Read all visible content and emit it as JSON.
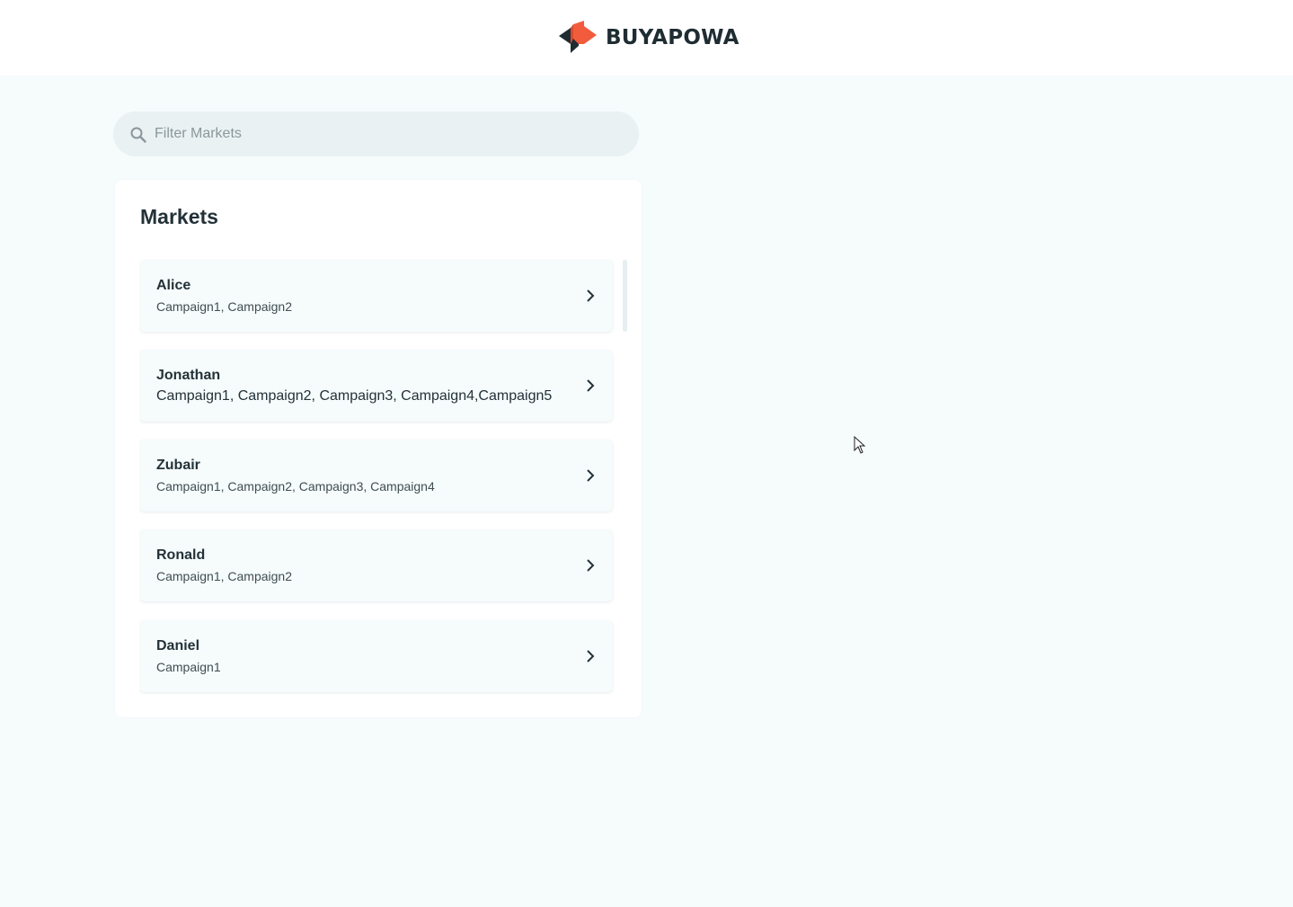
{
  "header": {
    "brand_name": "BUYAPOWA",
    "logo_colors": {
      "primary": "#f25c3c",
      "secondary": "#1f2d33"
    }
  },
  "search": {
    "placeholder": "Filter Markets",
    "value": "",
    "icon": "search-icon"
  },
  "markets": {
    "title": "Markets",
    "items": [
      {
        "name": "Alice",
        "campaigns": "Campaign1, Campaign2"
      },
      {
        "name": "Jonathan",
        "campaigns": "Campaign1, Campaign2, Campaign3, Campaign4,Campaign5"
      },
      {
        "name": "Zubair",
        "campaigns": "Campaign1, Campaign2, Campaign3, Campaign4"
      },
      {
        "name": "Ronald",
        "campaigns": "Campaign1, Campaign2"
      },
      {
        "name": "Daniel",
        "campaigns": "Campaign1"
      }
    ],
    "item_icon": "chevron-right-icon"
  },
  "colors": {
    "background": "#f6fbfc",
    "text": "#233238",
    "search_bg": "#e9f1f3",
    "accent": "#f25c3c"
  }
}
